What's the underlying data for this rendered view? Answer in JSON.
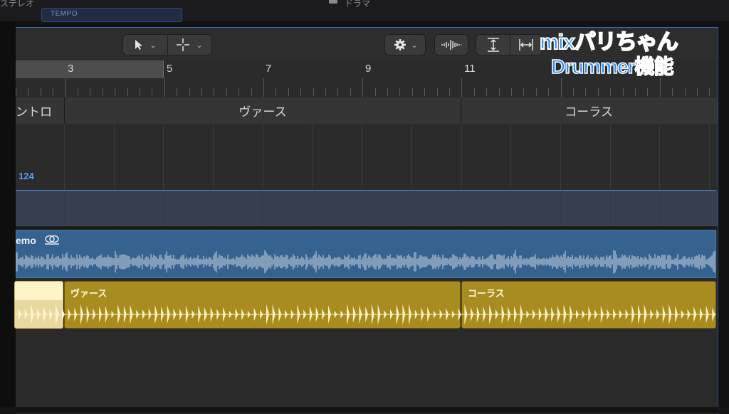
{
  "top_strip": {
    "left_label": "ステレオ",
    "center_label": "ドラマ",
    "tempo_chip": "TEMPO"
  },
  "toolbar": {
    "pointer_tool": "pointer-tool",
    "pencil_tool": "crosshair-tool",
    "settings": "gear",
    "waveform": "waveform",
    "vertical_zoom": "vertical-zoom",
    "horizontal_zoom": "horizontal-zoom"
  },
  "ruler": {
    "bars": [
      "3",
      "5",
      "7",
      "9",
      "11"
    ]
  },
  "arrangement": {
    "markers": [
      {
        "label": "ントロ"
      },
      {
        "label": "ヴァース"
      },
      {
        "label": "コーラス"
      }
    ]
  },
  "tempo_track": {
    "value": "124"
  },
  "audio_track": {
    "name": "emo"
  },
  "drummer_regions": [
    {
      "label": ""
    },
    {
      "label": "ヴァース"
    },
    {
      "label": "コーラス"
    }
  ],
  "overlay_logo": {
    "line1": "mixパリちゃん",
    "line2": "Drummer機能"
  },
  "colors": {
    "tempo_blue": "#4a88d6",
    "audio_region": "#35628f",
    "drummer_region": "#a98c20"
  }
}
